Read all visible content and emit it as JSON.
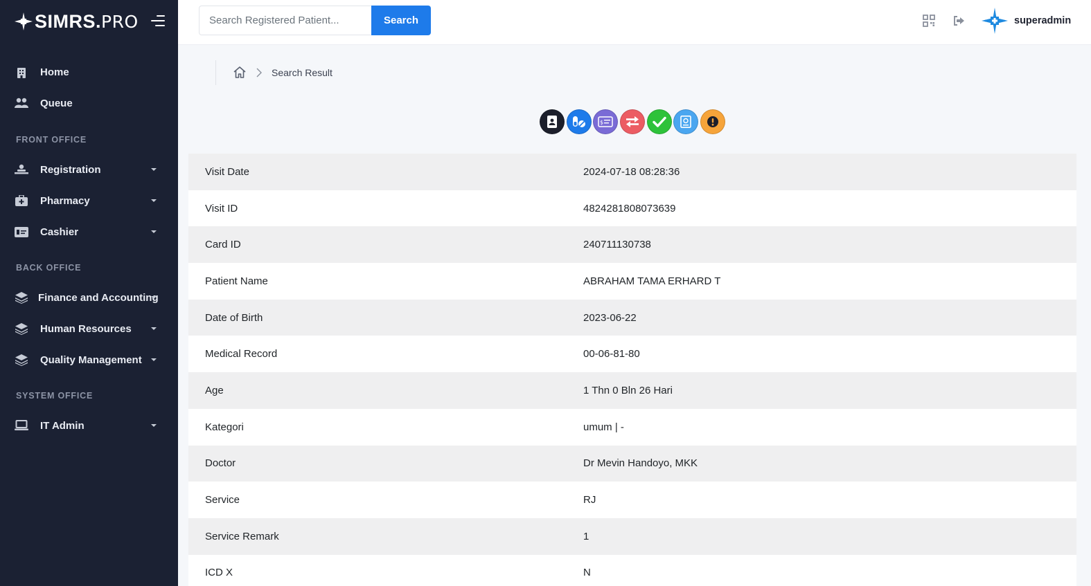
{
  "brand": {
    "name_bold": "SIMRS.",
    "name_light": "PRO"
  },
  "sidebar": {
    "items_top": [
      {
        "label": "Home",
        "icon": "hospital-icon"
      },
      {
        "label": "Queue",
        "icon": "users-icon"
      }
    ],
    "sections": [
      {
        "title": "FRONT OFFICE"
      },
      {
        "title": "BACK OFFICE"
      },
      {
        "title": "SYSTEM OFFICE"
      }
    ],
    "front_office": [
      {
        "label": "Registration",
        "icon": "patient-bed-icon"
      },
      {
        "label": "Pharmacy",
        "icon": "medkit-icon"
      },
      {
        "label": "Cashier",
        "icon": "money-card-icon"
      }
    ],
    "back_office": [
      {
        "label": "Finance and Accounting",
        "icon": "layers-icon"
      },
      {
        "label": "Human Resources",
        "icon": "layers-icon"
      },
      {
        "label": "Quality Management",
        "icon": "layers-icon"
      }
    ],
    "system_office": [
      {
        "label": "IT Admin",
        "icon": "laptop-icon"
      }
    ]
  },
  "topbar": {
    "search_placeholder": "Search Registered Patient...",
    "search_value": "",
    "search_button": "Search",
    "username": "superadmin"
  },
  "breadcrumb": {
    "current": "Search Result"
  },
  "actions": [
    {
      "name": "patient-card",
      "color": "#1c1f2b"
    },
    {
      "name": "medicine",
      "color": "#1e7bea"
    },
    {
      "name": "billing",
      "color": "#7a6bd6"
    },
    {
      "name": "transfer",
      "color": "#ec5c63"
    },
    {
      "name": "approve",
      "color": "#2ec23a"
    },
    {
      "name": "medical-book",
      "color": "#4aa6f0"
    },
    {
      "name": "alert",
      "color": "#f6a43a"
    }
  ],
  "details": [
    {
      "label": "Visit Date",
      "value": "2024-07-18 08:28:36"
    },
    {
      "label": "Visit ID",
      "value": "4824281808073639"
    },
    {
      "label": "Card ID",
      "value": "240711130738"
    },
    {
      "label": "Patient Name",
      "value": "ABRAHAM TAMA ERHARD T"
    },
    {
      "label": "Date of Birth",
      "value": "2023-06-22"
    },
    {
      "label": "Medical Record",
      "value": "00-06-81-80"
    },
    {
      "label": "Age",
      "value": "1 Thn 0 Bln 26 Hari"
    },
    {
      "label": "Kategori",
      "value": "umum | -"
    },
    {
      "label": "Doctor",
      "value": "Dr Mevin Handoyo, MKK"
    },
    {
      "label": "Service",
      "value": "RJ"
    },
    {
      "label": "Service Remark",
      "value": "1"
    },
    {
      "label": "ICD X",
      "value": "N"
    }
  ]
}
